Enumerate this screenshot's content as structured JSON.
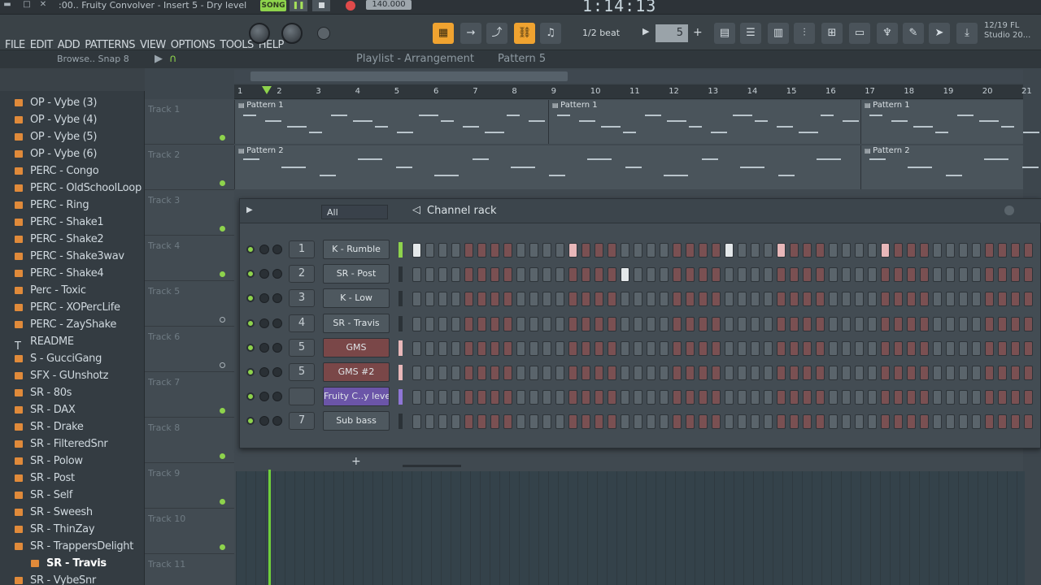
{
  "titlebar": {
    "hint": ":00.. Fruity Convolver - Insert 5 - Dry level",
    "song_label": "SONG",
    "tempo": "140.000",
    "time": "1:14:13"
  },
  "menu": [
    "FILE",
    "EDIT",
    "ADD",
    "PATTERNS",
    "VIEW",
    "OPTIONS",
    "TOOLS",
    "HELP"
  ],
  "toolbar": {
    "snap": "1/2 beat",
    "pattern_number": "5",
    "clock_line1": "12/19  FL",
    "clock_line2": "Studio 20..."
  },
  "browser": {
    "header": "Browse.. Snap 8",
    "items": [
      "OP - Vybe (3)",
      "OP - Vybe (4)",
      "OP - Vybe (5)",
      "OP - Vybe (6)",
      "PERC - Congo",
      "PERC - OldSchoolLoop",
      "PERC - Ring",
      "PERC - Shake1",
      "PERC - Shake2",
      "PERC - Shake3wav",
      "PERC - Shake4",
      "Perc - Toxic",
      "PERC - XOPercLife",
      "PERC - ZayShake",
      "README",
      "S - GucciGang",
      "SFX - GUnshotz",
      "SR - 80s",
      "SR - DAX",
      "SR - Drake",
      "SR - FilteredSnr",
      "SR - Polow",
      "SR - Post",
      "SR - Self",
      "SR - Sweesh",
      "SR - ThinZay",
      "SR - TrappersDelight",
      "SR - Travis",
      "SR - VybeSnr"
    ],
    "selected": "SR - Travis"
  },
  "playlist": {
    "title": "Playlist - Arrangement",
    "pattern": "Pattern 5",
    "ruler": [
      "1",
      "2",
      "3",
      "4",
      "5",
      "6",
      "7",
      "8",
      "9",
      "10",
      "11",
      "12",
      "13",
      "14",
      "15",
      "16",
      "17",
      "18",
      "19",
      "20",
      "21"
    ],
    "tracks": [
      "Track 1",
      "Track 2",
      "Track 3",
      "Track 4",
      "Track 5",
      "Track 6",
      "Track 7",
      "Track 8",
      "Track 9",
      "Track 10",
      "Track 11"
    ],
    "clips_row1": [
      "Pattern 1",
      "Pattern 1",
      "Pattern 1"
    ],
    "clips_row2": [
      "Pattern 2",
      "Pattern 2"
    ]
  },
  "channel_rack": {
    "title": "Channel rack",
    "filter": "All",
    "channels": [
      {
        "num": "1",
        "name": "K - Rumble",
        "style": "grey"
      },
      {
        "num": "2",
        "name": "SR - Post",
        "style": "grey"
      },
      {
        "num": "3",
        "name": "K - Low",
        "style": "grey"
      },
      {
        "num": "4",
        "name": "SR - Travis",
        "style": "grey"
      },
      {
        "num": "5",
        "name": "GMS",
        "style": "red"
      },
      {
        "num": "5",
        "name": "GMS #2",
        "style": "red"
      },
      {
        "num": "",
        "name": "Fruity C..y level",
        "style": "purple"
      },
      {
        "num": "7",
        "name": "Sub bass",
        "style": "grey"
      }
    ],
    "add_label": "+"
  },
  "colors": {
    "accent": "#f0a330",
    "green": "#8ed34c"
  }
}
